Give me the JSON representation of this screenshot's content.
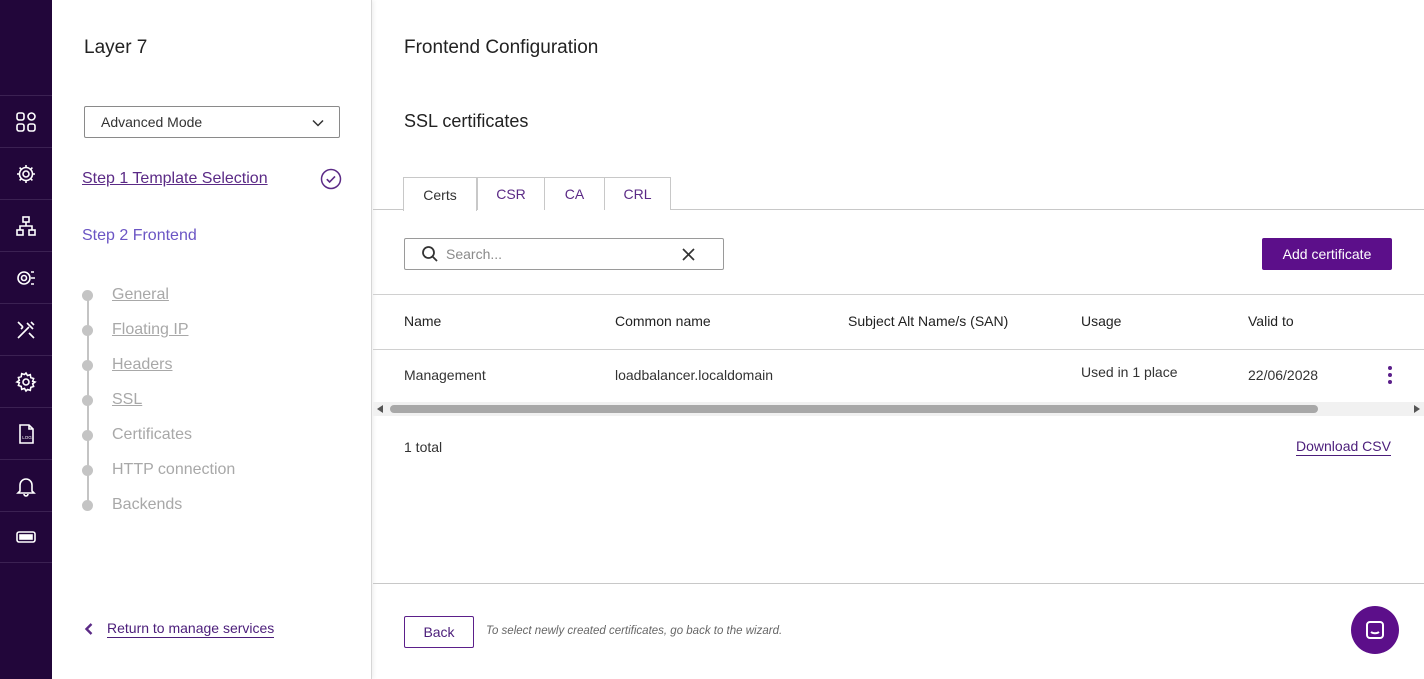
{
  "rail": {
    "items": [
      {
        "icon": "dashboard-icon"
      },
      {
        "icon": "services-icon"
      },
      {
        "icon": "network-icon"
      },
      {
        "icon": "cluster-settings-icon"
      },
      {
        "icon": "tools-icon"
      },
      {
        "icon": "settings-icon"
      },
      {
        "icon": "log-icon",
        "label": "LOG"
      },
      {
        "icon": "notifications-icon"
      },
      {
        "icon": "license-icon"
      }
    ]
  },
  "wizard": {
    "title": "Layer 7",
    "mode": "Advanced Mode",
    "step1": "Step 1 Template Selection",
    "step2": "Step 2 Frontend",
    "substeps": [
      {
        "label": "General",
        "link": true
      },
      {
        "label": "Floating IP",
        "link": true
      },
      {
        "label": "Headers",
        "link": true
      },
      {
        "label": "SSL",
        "link": true
      },
      {
        "label": "Certificates",
        "link": false
      },
      {
        "label": "HTTP connection",
        "link": false
      },
      {
        "label": "Backends",
        "link": false
      }
    ],
    "return_label": "Return to manage services"
  },
  "main": {
    "title": "Frontend Configuration",
    "section": "SSL certificates",
    "tabs": [
      {
        "label": "Certs",
        "active": true
      },
      {
        "label": "CSR",
        "active": false
      },
      {
        "label": "CA",
        "active": false
      },
      {
        "label": "CRL",
        "active": false
      }
    ],
    "search_placeholder": "Search...",
    "add_label": "Add certificate",
    "table": {
      "columns": [
        "Name",
        "Common name",
        "Subject Alt Name/s (SAN)",
        "Usage",
        "Valid to"
      ],
      "rows": [
        {
          "name": "Management",
          "common_name": "loadbalancer.localdomain",
          "san": "",
          "usage": "Used in 1 place",
          "valid_to": "22/06/2028"
        }
      ]
    },
    "total": "1 total",
    "csv_label": "Download CSV",
    "back_label": "Back",
    "hint": "To select newly created certificates, go back to the wizard."
  },
  "colors": {
    "rail": "#22063a",
    "accent": "#5c0f8a",
    "link": "#4b1d7a",
    "step2": "#6b55c4",
    "muted": "#a8a8a8"
  }
}
